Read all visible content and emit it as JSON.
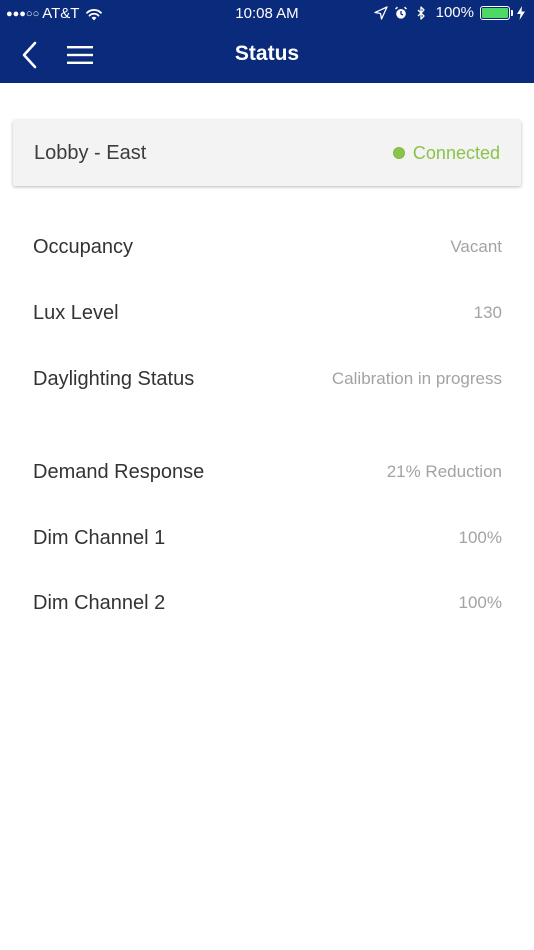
{
  "statusbar": {
    "signal_dots": "●●●○○",
    "carrier": "AT&T",
    "time": "10:08 AM",
    "battery_pct": "100%",
    "icons": [
      "wifi-icon",
      "location-icon",
      "alarm-icon",
      "bluetooth-icon",
      "battery-icon",
      "charging-icon"
    ],
    "battery_level": 1.0
  },
  "nav": {
    "title": "Status",
    "back_icon": "chevron-left-icon",
    "menu_icon": "hamburger-menu-icon"
  },
  "device": {
    "name": "Lobby - East",
    "status": "Connected",
    "status_color": "#8bc34a"
  },
  "rows": [
    {
      "label": "Occupancy",
      "value": "Vacant"
    },
    {
      "label": "Lux Level",
      "value": "130"
    },
    {
      "label": "Daylighting Status",
      "value": "Calibration in progress"
    },
    {
      "label": "Demand Response",
      "value": "21% Reduction"
    },
    {
      "label": "Dim Channel 1",
      "value": "100%"
    },
    {
      "label": "Dim Channel 2",
      "value": "100%"
    }
  ],
  "colors": {
    "header": "#0a2a7c",
    "label": "#333333",
    "value": "#a3a3a3"
  }
}
